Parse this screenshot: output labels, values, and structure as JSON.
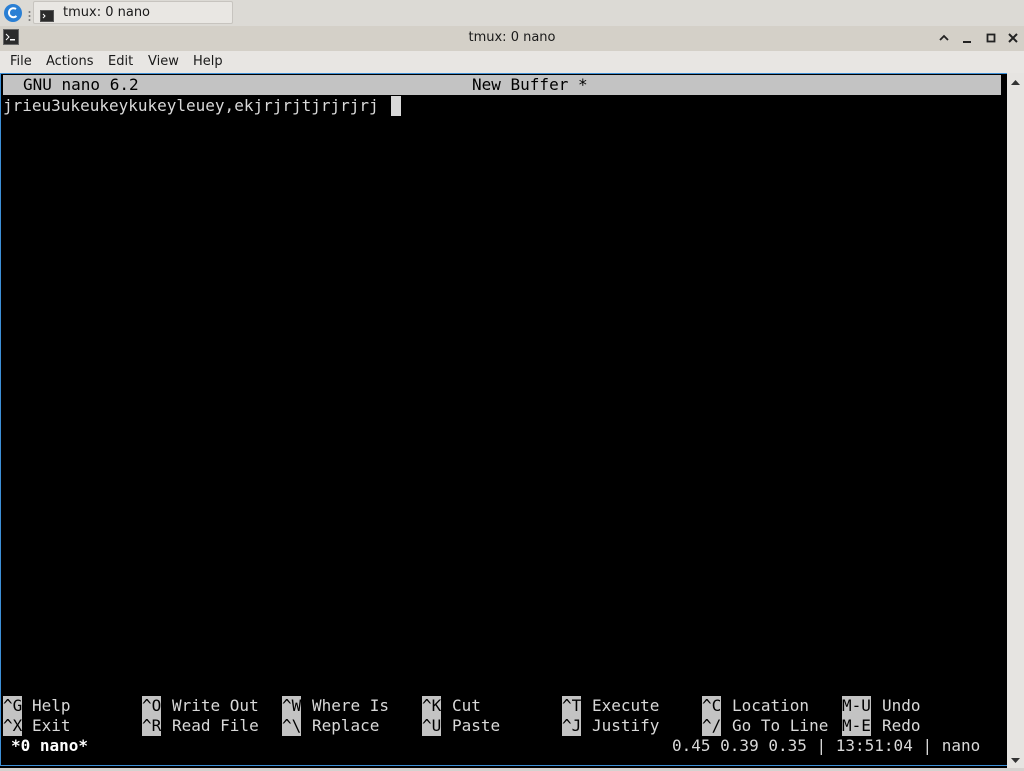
{
  "taskbar": {
    "start_icon": "debian-swirl-icon",
    "task_title": "tmux: 0 nano",
    "task_icon": "terminal-icon"
  },
  "window": {
    "title": "tmux: 0 nano",
    "controls": [
      "chevron-up-icon",
      "minimize-icon",
      "maximize-icon",
      "close-icon"
    ]
  },
  "menubar": {
    "file": "File",
    "actions": "Actions",
    "edit": "Edit",
    "view": "View",
    "help": "Help"
  },
  "nano": {
    "version": "GNU nano 6.2",
    "filename": "New Buffer *",
    "buffer_text": "jrieu3ukeukeykukeyleuey,ekjrjrjtjrjrjrj",
    "shortcuts_row1": [
      {
        "key": "^G",
        "label": "Help"
      },
      {
        "key": "^O",
        "label": "Write Out"
      },
      {
        "key": "^W",
        "label": "Where Is"
      },
      {
        "key": "^K",
        "label": "Cut"
      },
      {
        "key": "^T",
        "label": "Execute"
      },
      {
        "key": "^C",
        "label": "Location"
      },
      {
        "key": "M-U",
        "label": "Undo"
      }
    ],
    "shortcuts_row2": [
      {
        "key": "^X",
        "label": "Exit"
      },
      {
        "key": "^R",
        "label": "Read File"
      },
      {
        "key": "^\\",
        "label": "Replace"
      },
      {
        "key": "^U",
        "label": "Paste"
      },
      {
        "key": "^J",
        "label": "Justify"
      },
      {
        "key": "^/",
        "label": "Go To Line"
      },
      {
        "key": "M-E",
        "label": "Redo"
      }
    ]
  },
  "tmux_status": {
    "window": "*0 nano*",
    "right": "0.45 0.39 0.35 | 13:51:04 | nano"
  },
  "colors": {
    "terminal_bg": "#000000",
    "terminal_fg": "#d9d9d9",
    "nano_bar_bg": "#c3c3c3",
    "focus_border": "#3d8fd6"
  }
}
